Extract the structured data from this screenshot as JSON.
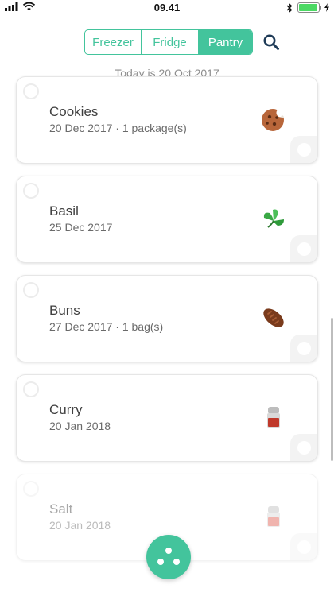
{
  "status_bar": {
    "time": "09.41"
  },
  "tabs": [
    {
      "label": "Freezer",
      "active": false
    },
    {
      "label": "Fridge",
      "active": false
    },
    {
      "label": "Pantry",
      "active": true
    }
  ],
  "today_text": "Today is 20 Oct 2017",
  "items": [
    {
      "name": "Cookies",
      "detail": "20 Dec 2017 · 1 package(s)",
      "icon": "cookie-icon"
    },
    {
      "name": "Basil",
      "detail": "25 Dec 2017",
      "icon": "basil-leaf-icon"
    },
    {
      "name": "Buns",
      "detail": "27 Dec 2017 · 1 bag(s)",
      "icon": "bread-bun-icon"
    },
    {
      "name": "Curry",
      "detail": "20 Jan 2018",
      "icon": "spice-jar-icon"
    },
    {
      "name": "Salt",
      "detail": "20 Jan 2018",
      "icon": "salt-shaker-icon"
    }
  ],
  "colors": {
    "accent": "#43c49c",
    "active_tab_text": "#ffffff"
  }
}
